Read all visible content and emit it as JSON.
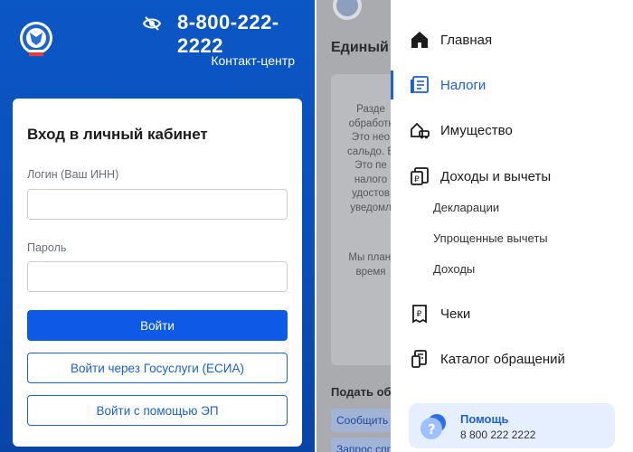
{
  "login": {
    "phone": "8-800-222-2222",
    "contact_link": "Контакт-центр",
    "title": "Вход в личный кабинет",
    "login_label": "Логин (Ваш ИНН)",
    "login_value": "",
    "password_label": "Пароль",
    "password_value": "",
    "submit_label": "Войти",
    "gosuslugi_label": "Войти через Госуслуги (ЕСИА)",
    "ep_label": "Войти с помощью ЭП"
  },
  "background_page": {
    "title": "Единый",
    "text_lines": [
      "Разде",
      "обработк",
      "Это нео",
      "сальдо. E",
      "Это пе",
      "налого",
      "удостов",
      "уведомл"
    ],
    "text_lines2": [
      "Мы плані",
      "время"
    ],
    "subtitle": "Подать об",
    "chips": [
      "Сообщить",
      "Запрос спр"
    ]
  },
  "menu": {
    "items": [
      {
        "label": "Главная",
        "icon": "home-icon"
      },
      {
        "label": "Налоги",
        "icon": "tax-document-icon",
        "active": true
      },
      {
        "label": "Имущество",
        "icon": "property-icon"
      },
      {
        "label": "Доходы и вычеты",
        "icon": "income-icon"
      },
      {
        "label": "Чеки",
        "icon": "receipt-icon"
      },
      {
        "label": "Каталог обращений",
        "icon": "catalog-icon"
      }
    ],
    "subitems": [
      "Декларации",
      "Упрощенные вычеты",
      "Доходы"
    ],
    "help_title": "Помощь",
    "help_phone": "8 800 222 2222"
  },
  "colors": {
    "brand_blue": "#0b57c5",
    "primary_button": "#0c5ae6",
    "accent": "#1b5fd9"
  }
}
